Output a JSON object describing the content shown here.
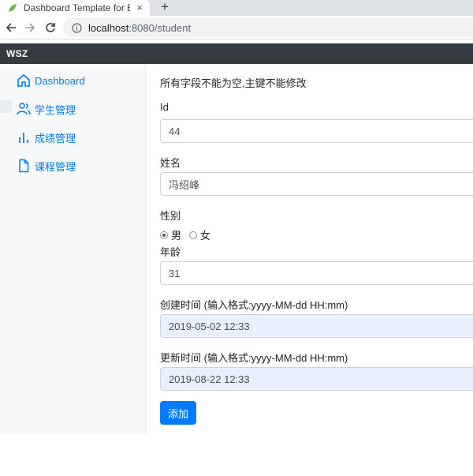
{
  "browser": {
    "tab_title": "Dashboard Template for Bootstrap",
    "close_glyph": "×",
    "new_tab_glyph": "+",
    "url_host": "localhost",
    "url_path": ":8080/student"
  },
  "navbar": {
    "brand": "WSZ"
  },
  "sidebar": {
    "items": [
      {
        "label": "Dashboard",
        "icon": "home-icon"
      },
      {
        "label": "学生管理",
        "icon": "users-icon"
      },
      {
        "label": "成绩管理",
        "icon": "bar-chart-icon"
      },
      {
        "label": "课程管理",
        "icon": "file-icon"
      }
    ]
  },
  "form": {
    "notice": "所有字段不能为空,主键不能修改",
    "id_label": "Id",
    "id_value": "44",
    "name_label": "姓名",
    "name_value": "冯绍峰",
    "gender_label": "性别",
    "gender_options": [
      "男",
      "女"
    ],
    "gender_selected": "男",
    "age_label": "年龄",
    "age_value": "31",
    "created_label": "创建时间 (输入格式:yyyy-MM-dd HH:mm)",
    "created_value": "2019-05-02 12:33",
    "updated_label": "更新时间 (输入格式:yyyy-MM-dd HH:mm)",
    "updated_value": "2019-08-22 12:33",
    "submit_label": "添加"
  },
  "colors": {
    "accent": "#007bff",
    "navbar_bg": "#343a40",
    "sidebar_bg": "#f8f9fa",
    "autofill_bg": "#e8f0fe"
  }
}
